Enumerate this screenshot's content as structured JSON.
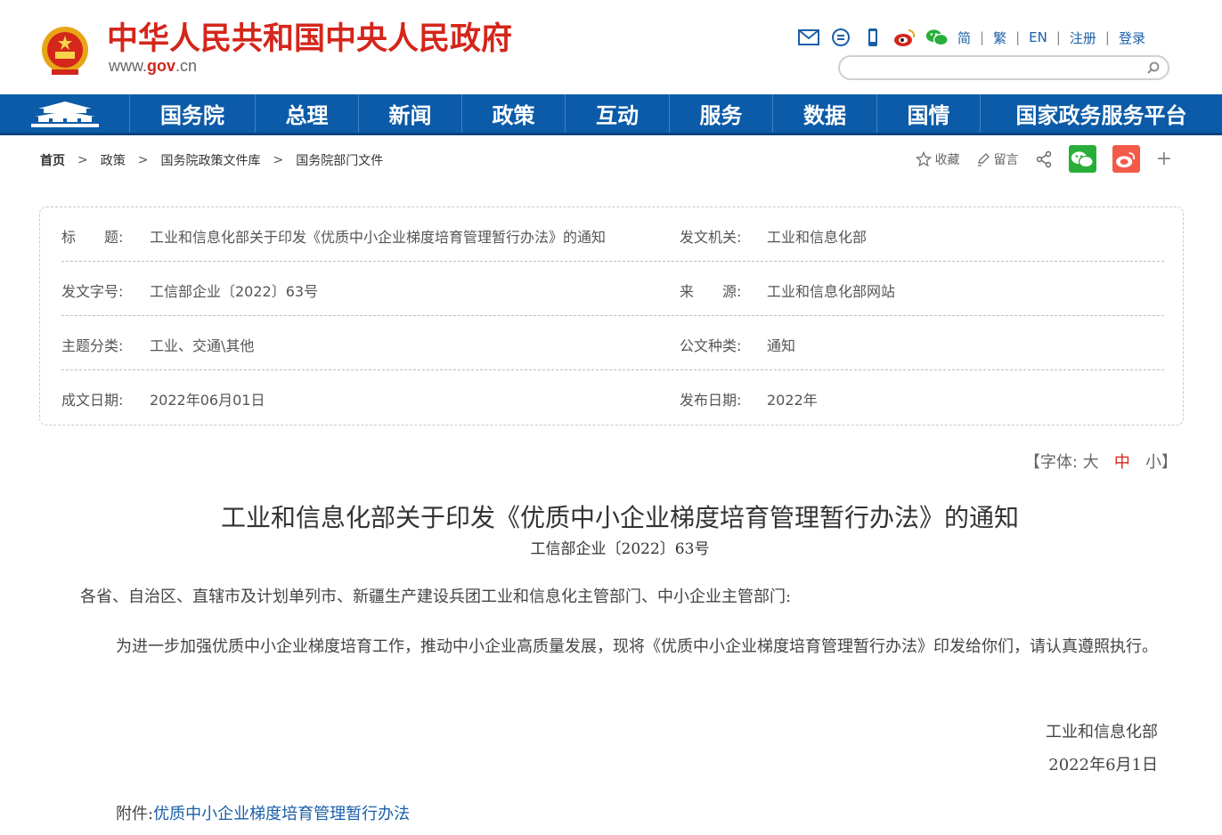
{
  "header": {
    "site_title": "中华人民共和国中央人民政府",
    "url_prefix": "www.",
    "url_brand": "gov",
    "url_suffix": ".cn",
    "links": [
      "简",
      "繁",
      "EN",
      "注册",
      "登录"
    ]
  },
  "nav": {
    "items": [
      "国务院",
      "总理",
      "新闻",
      "政策",
      "互动",
      "服务",
      "数据",
      "国情",
      "国家政务服务平台"
    ]
  },
  "breadcrumb": [
    "首页",
    "政策",
    "国务院政策文件库",
    "国务院部门文件"
  ],
  "tools": {
    "favorite": "收藏",
    "comment": "留言",
    "plus": "+"
  },
  "info": {
    "title_label": "标　　题:",
    "title_value": "工业和信息化部关于印发《优质中小企业梯度培育管理暂行办法》的通知",
    "issuer_label": "发文机关:",
    "issuer_value": "工业和信息化部",
    "docno_label": "发文字号:",
    "docno_value": "工信部企业〔2022〕63号",
    "source_label": "来　　源:",
    "source_value": "工业和信息化部网站",
    "topic_label": "主题分类:",
    "topic_value": "工业、交通\\其他",
    "type_label": "公文种类:",
    "type_value": "通知",
    "written_label": "成文日期:",
    "written_value": "2022年06月01日",
    "published_label": "发布日期:",
    "published_value": "2022年"
  },
  "fontsize": {
    "prefix": "【字体:",
    "large": "大",
    "medium": "中",
    "small": "小",
    "suffix": "】"
  },
  "article": {
    "title": "工业和信息化部关于印发《优质中小企业梯度培育管理暂行办法》的通知",
    "docno": "工信部企业〔2022〕63号",
    "p1": "各省、自治区、直辖市及计划单列市、新疆生产建设兵团工业和信息化主管部门、中小企业主管部门:",
    "p2": "为进一步加强优质中小企业梯度培育工作，推动中小企业高质量发展，现将《优质中小企业梯度培育管理暂行办法》印发给你们，请认真遵照执行。",
    "signature": "工业和信息化部",
    "date": "2022年6月1日",
    "attach_label": "附件:",
    "attach_link": "优质中小企业梯度培育管理暂行办法"
  },
  "colors": {
    "brand_red": "#d4261b",
    "nav_blue": "#0b5ba8",
    "link_blue": "#1a5fa8"
  }
}
